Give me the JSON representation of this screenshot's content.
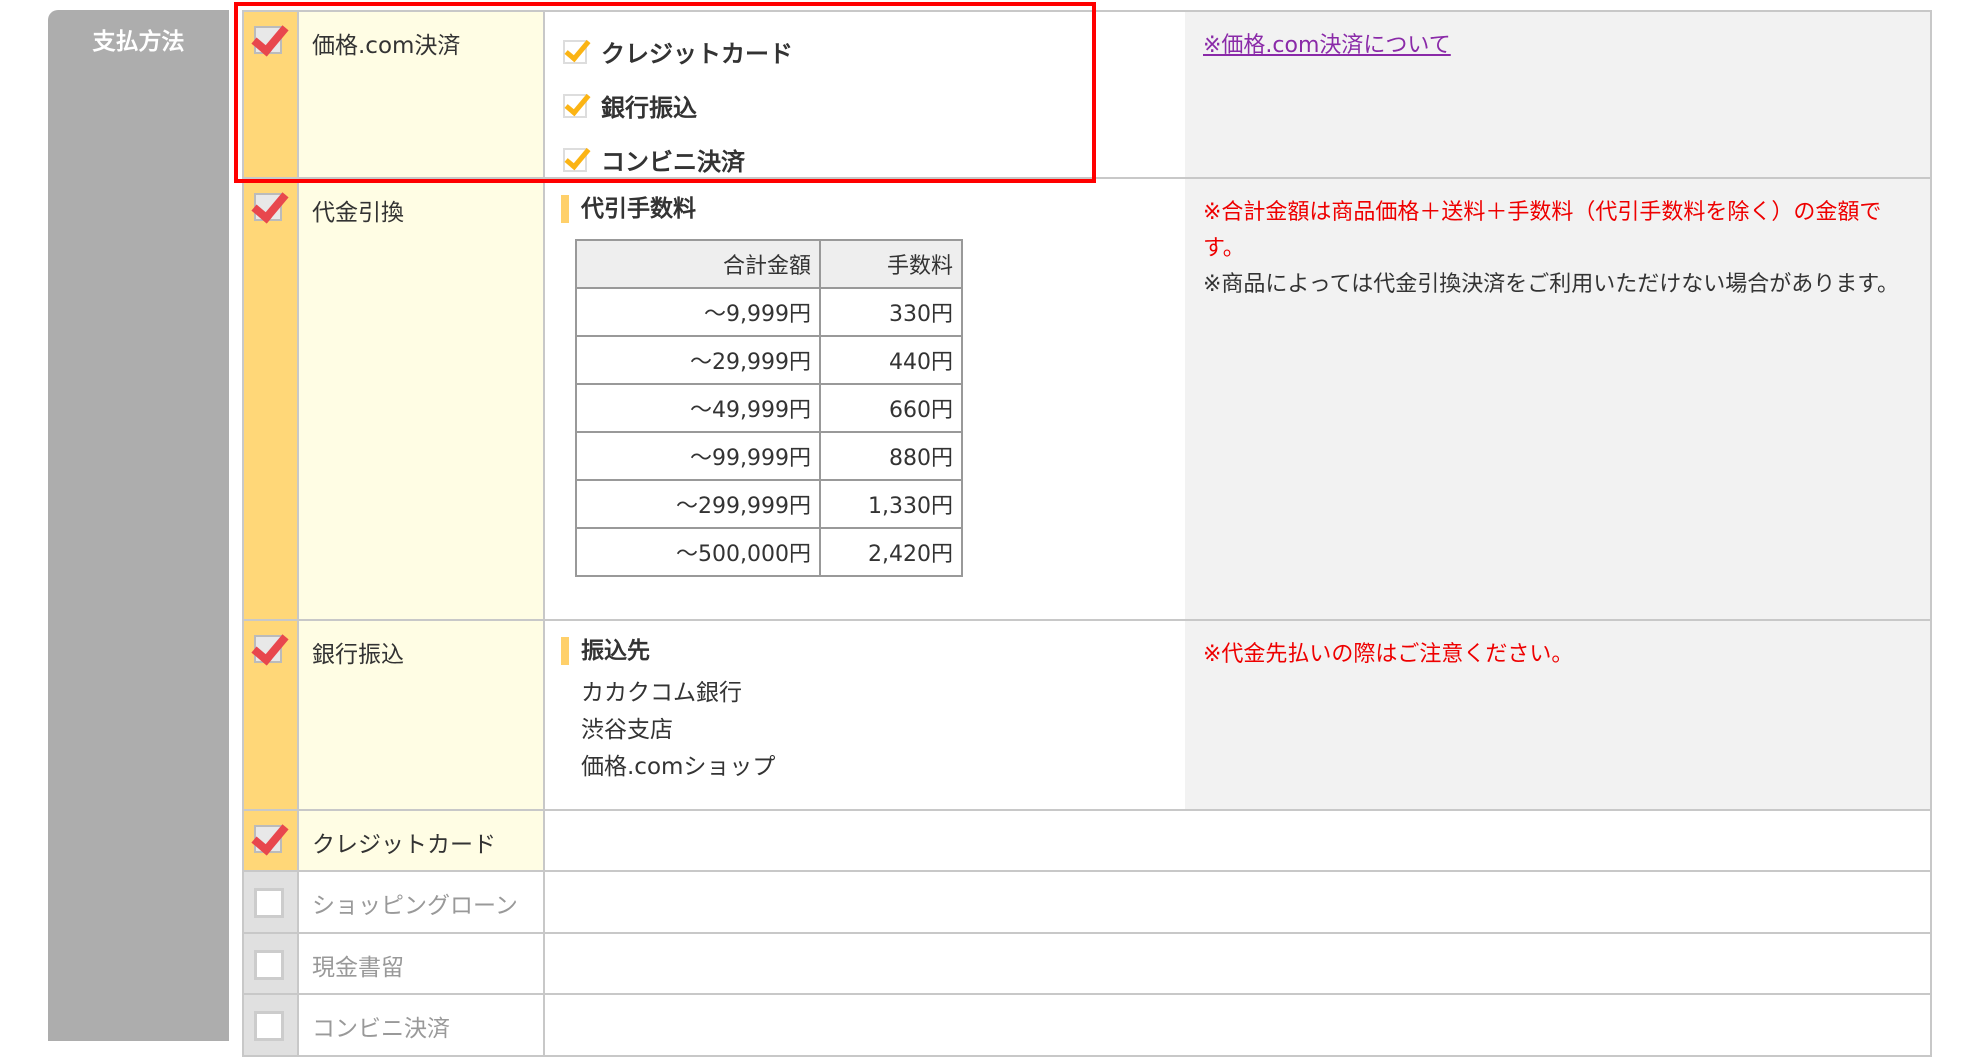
{
  "section_label": "支払方法",
  "kakaku": {
    "label": "価格.com決済",
    "options": [
      "クレジットカード",
      "銀行振込",
      "コンビニ決済"
    ],
    "link": "※価格.com決済について"
  },
  "cod": {
    "label": "代金引換",
    "heading": "代引手数料",
    "columns": [
      "合計金額",
      "手数料"
    ],
    "rows": [
      [
        "～9,999円",
        "330円"
      ],
      [
        "～29,999円",
        "440円"
      ],
      [
        "～49,999円",
        "660円"
      ],
      [
        "～99,999円",
        "880円"
      ],
      [
        "～299,999円",
        "1,330円"
      ],
      [
        "～500,000円",
        "2,420円"
      ]
    ],
    "notes": [
      "※合計金額は商品価格＋送料＋手数料（代引手数料を除く）の金額です。",
      "※商品によっては代金引換決済をご利用いただけない場合があります。"
    ]
  },
  "bank": {
    "label": "銀行振込",
    "heading": "振込先",
    "lines": [
      "カカクコム銀行",
      "渋谷支店",
      "価格.comショップ"
    ],
    "note": "※代金先払いの際はご注意ください。"
  },
  "credit": {
    "label": "クレジットカード"
  },
  "disabled": [
    "ショッピングローン",
    "現金書留",
    "コンビニ決済"
  ]
}
